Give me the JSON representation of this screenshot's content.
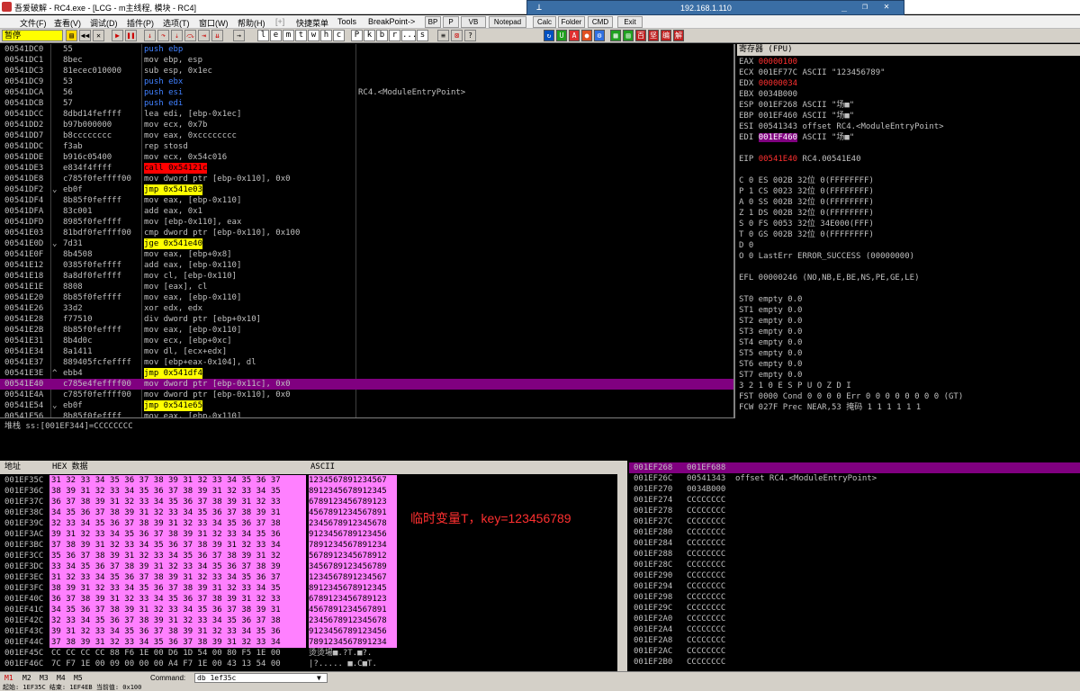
{
  "window": {
    "title": "吾爱破解 - RC4.exe - [LCG - m主线程, 模块 - RC4]"
  },
  "rdp": {
    "ip": "192.168.1.110"
  },
  "menu": [
    "文件(F)",
    "查看(V)",
    "调试(D)",
    "插件(P)",
    "选项(T)",
    "窗口(W)",
    "帮助(H)",
    "[+]",
    "快捷菜单",
    "Tools",
    "BreakPoint->"
  ],
  "plugin_buttons": [
    "BP",
    "P",
    "VB",
    "Notepad",
    "Calc",
    "Folder",
    "CMD",
    "Exit"
  ],
  "toolbar": {
    "status": "暂停",
    "letters": [
      "l",
      "e",
      "m",
      "t",
      "w",
      "h",
      "c",
      "P",
      "k",
      "b",
      "r",
      "...",
      "s"
    ]
  },
  "disasm": [
    {
      "addr": "00541DC0",
      "jmp": "",
      "hex": "55",
      "asm": "push ebp",
      "cls": "push",
      "cmt": ""
    },
    {
      "addr": "00541DC1",
      "jmp": "",
      "hex": "8bec",
      "asm": "mov ebp, esp",
      "cls": "",
      "cmt": ""
    },
    {
      "addr": "00541DC3",
      "jmp": "",
      "hex": "81ecec010000",
      "asm": "sub esp, 0x1ec",
      "cls": "",
      "cmt": ""
    },
    {
      "addr": "00541DC9",
      "jmp": "",
      "hex": "53",
      "asm": "push ebx",
      "cls": "push",
      "cmt": ""
    },
    {
      "addr": "00541DCA",
      "jmp": "",
      "hex": "56",
      "asm": "push esi",
      "cls": "push",
      "cmt": "RC4.<ModuleEntryPoint>"
    },
    {
      "addr": "00541DCB",
      "jmp": "",
      "hex": "57",
      "asm": "push edi",
      "cls": "push",
      "cmt": ""
    },
    {
      "addr": "00541DCC",
      "jmp": "",
      "hex": "8dbd14feffff",
      "asm": "lea edi, [ebp-0x1ec]",
      "cls": "",
      "cmt": ""
    },
    {
      "addr": "00541DD2",
      "jmp": "",
      "hex": "b97b000000",
      "asm": "mov ecx, 0x7b",
      "cls": "",
      "cmt": ""
    },
    {
      "addr": "00541DD7",
      "jmp": "",
      "hex": "b8cccccccc",
      "asm": "mov eax, 0xcccccccc",
      "cls": "",
      "cmt": ""
    },
    {
      "addr": "00541DDC",
      "jmp": "",
      "hex": "f3ab",
      "asm": "rep stosd",
      "cls": "",
      "cmt": ""
    },
    {
      "addr": "00541DDE",
      "jmp": "",
      "hex": "b916c05400",
      "asm": "mov ecx, 0x54c016",
      "cls": "",
      "cmt": ""
    },
    {
      "addr": "00541DE3",
      "jmp": "",
      "hex": "e834f4ffff",
      "asm": "call 0x54121c",
      "cls": "call",
      "cmt": ""
    },
    {
      "addr": "00541DE8",
      "jmp": "",
      "hex": "c785f0feffff00",
      "asm": "mov dword ptr [ebp-0x110], 0x0",
      "cls": "",
      "cmt": ""
    },
    {
      "addr": "00541DF2",
      "jmp": "⌄",
      "hex": "eb0f",
      "asm": "jmp 0x541e03",
      "cls": "jmp",
      "cmt": ""
    },
    {
      "addr": "00541DF4",
      "jmp": "",
      "hex": "8b85f0feffff",
      "asm": "mov eax, [ebp-0x110]",
      "cls": "",
      "cmt": ""
    },
    {
      "addr": "00541DFA",
      "jmp": "",
      "hex": "83c001",
      "asm": "add eax, 0x1",
      "cls": "",
      "cmt": ""
    },
    {
      "addr": "00541DFD",
      "jmp": "",
      "hex": "8985f0feffff",
      "asm": "mov [ebp-0x110], eax",
      "cls": "",
      "cmt": ""
    },
    {
      "addr": "00541E03",
      "jmp": "",
      "hex": "81bdf0feffff00",
      "asm": "cmp dword ptr [ebp-0x110], 0x100",
      "cls": "",
      "cmt": ""
    },
    {
      "addr": "00541E0D",
      "jmp": "⌄",
      "hex": "7d31",
      "asm": "jge 0x541e40",
      "cls": "jmp",
      "cmt": ""
    },
    {
      "addr": "00541E0F",
      "jmp": "",
      "hex": "8b4508",
      "asm": "mov eax, [ebp+0x8]",
      "cls": "",
      "cmt": ""
    },
    {
      "addr": "00541E12",
      "jmp": "",
      "hex": "0385f0feffff",
      "asm": "add eax, [ebp-0x110]",
      "cls": "",
      "cmt": ""
    },
    {
      "addr": "00541E18",
      "jmp": "",
      "hex": "8a8df0feffff",
      "asm": "mov cl, [ebp-0x110]",
      "cls": "",
      "cmt": ""
    },
    {
      "addr": "00541E1E",
      "jmp": "",
      "hex": "8808",
      "asm": "mov [eax], cl",
      "cls": "",
      "cmt": ""
    },
    {
      "addr": "00541E20",
      "jmp": "",
      "hex": "8b85f0feffff",
      "asm": "mov eax, [ebp-0x110]",
      "cls": "",
      "cmt": ""
    },
    {
      "addr": "00541E26",
      "jmp": "",
      "hex": "33d2",
      "asm": "xor edx, edx",
      "cls": "",
      "cmt": ""
    },
    {
      "addr": "00541E28",
      "jmp": "",
      "hex": "f77510",
      "asm": "div dword ptr [ebp+0x10]",
      "cls": "",
      "cmt": ""
    },
    {
      "addr": "00541E2B",
      "jmp": "",
      "hex": "8b85f0feffff",
      "asm": "mov eax, [ebp-0x110]",
      "cls": "",
      "cmt": ""
    },
    {
      "addr": "00541E31",
      "jmp": "",
      "hex": "8b4d0c",
      "asm": "mov ecx, [ebp+0xc]",
      "cls": "",
      "cmt": ""
    },
    {
      "addr": "00541E34",
      "jmp": "",
      "hex": "8a1411",
      "asm": "mov dl, [ecx+edx]",
      "cls": "",
      "cmt": ""
    },
    {
      "addr": "00541E37",
      "jmp": "",
      "hex": "889405fcfeffff",
      "asm": "mov [ebp+eax-0x104], dl",
      "cls": "",
      "cmt": ""
    },
    {
      "addr": "00541E3E",
      "jmp": "^",
      "hex": "ebb4",
      "asm": "jmp 0x541df4",
      "cls": "jmp",
      "cmt": ""
    },
    {
      "addr": "00541E40",
      "jmp": "",
      "hex": "c785e4feffff00",
      "asm": "mov dword ptr [ebp-0x11c], 0x0",
      "cls": "",
      "cmt": "",
      "sel": true
    },
    {
      "addr": "00541E4A",
      "jmp": "",
      "hex": "c785f0feffff00",
      "asm": "mov dword ptr [ebp-0x110], 0x0",
      "cls": "",
      "cmt": ""
    },
    {
      "addr": "00541E54",
      "jmp": "⌄",
      "hex": "eb0f",
      "asm": "jmp 0x541e65",
      "cls": "jmp",
      "cmt": ""
    },
    {
      "addr": "00541E56",
      "jmp": "",
      "hex": "8b85f0feffff",
      "asm": "mov eax, [ebp-0x110]",
      "cls": "",
      "cmt": ""
    }
  ],
  "registers": {
    "header": "寄存器 (FPU)",
    "lines": [
      [
        {
          "t": "EAX ",
          "c": "#c0c0c0"
        },
        {
          "t": "00000100",
          "c": "#ff3030"
        }
      ],
      [
        {
          "t": "ECX 001EF77C ASCII \"123456789\"",
          "c": "#c0c0c0"
        }
      ],
      [
        {
          "t": "EDX ",
          "c": "#c0c0c0"
        },
        {
          "t": "00000034",
          "c": "#ff3030"
        }
      ],
      [
        {
          "t": "EBX 0034B000",
          "c": "#c0c0c0"
        }
      ],
      [
        {
          "t": "ESP 001EF268 ASCII \"场■\"",
          "c": "#c0c0c0"
        }
      ],
      [
        {
          "t": "EBP 001EF460 ASCII \"场■\"",
          "c": "#c0c0c0"
        }
      ],
      [
        {
          "t": "ESI 00541343 offset RC4.<ModuleEntryPoint>",
          "c": "#c0c0c0"
        }
      ],
      [
        {
          "t": "EDI ",
          "c": "#c0c0c0"
        },
        {
          "t": "001EF460",
          "c": "#fff",
          "bg": "#800080"
        },
        {
          "t": " ASCII \"场■\"",
          "c": "#c0c0c0"
        }
      ],
      [
        {
          "t": "",
          "c": "#c0c0c0"
        }
      ],
      [
        {
          "t": "EIP ",
          "c": "#c0c0c0"
        },
        {
          "t": "00541E40",
          "c": "#ff3030"
        },
        {
          "t": " RC4.00541E40",
          "c": "#c0c0c0"
        }
      ],
      [
        {
          "t": "",
          "c": "#c0c0c0"
        }
      ],
      [
        {
          "t": "C 0  ES 002B 32位 0(FFFFFFFF)",
          "c": "#c0c0c0"
        }
      ],
      [
        {
          "t": "P 1  CS 0023 32位 0(FFFFFFFF)",
          "c": "#c0c0c0"
        }
      ],
      [
        {
          "t": "A 0  SS 002B 32位 0(FFFFFFFF)",
          "c": "#c0c0c0"
        }
      ],
      [
        {
          "t": "Z 1  DS 002B 32位 0(FFFFFFFF)",
          "c": "#c0c0c0"
        }
      ],
      [
        {
          "t": "S 0  FS 0053 32位 34E000(FFF)",
          "c": "#c0c0c0"
        }
      ],
      [
        {
          "t": "T 0  GS 002B 32位 0(FFFFFFFF)",
          "c": "#c0c0c0"
        }
      ],
      [
        {
          "t": "D 0",
          "c": "#c0c0c0"
        }
      ],
      [
        {
          "t": "O 0  LastErr ERROR_SUCCESS (00000000)",
          "c": "#c0c0c0"
        }
      ],
      [
        {
          "t": "",
          "c": "#c0c0c0"
        }
      ],
      [
        {
          "t": "EFL 00000246 (NO,NB,E,BE,NS,PE,GE,LE)",
          "c": "#c0c0c0"
        }
      ],
      [
        {
          "t": "",
          "c": "#c0c0c0"
        }
      ],
      [
        {
          "t": "ST0 empty 0.0",
          "c": "#c0c0c0"
        }
      ],
      [
        {
          "t": "ST1 empty 0.0",
          "c": "#c0c0c0"
        }
      ],
      [
        {
          "t": "ST2 empty 0.0",
          "c": "#c0c0c0"
        }
      ],
      [
        {
          "t": "ST3 empty 0.0",
          "c": "#c0c0c0"
        }
      ],
      [
        {
          "t": "ST4 empty 0.0",
          "c": "#c0c0c0"
        }
      ],
      [
        {
          "t": "ST5 empty 0.0",
          "c": "#c0c0c0"
        }
      ],
      [
        {
          "t": "ST6 empty 0.0",
          "c": "#c0c0c0"
        }
      ],
      [
        {
          "t": "ST7 empty 0.0",
          "c": "#c0c0c0"
        }
      ],
      [
        {
          "t": "               3 2 1 0      E S P U O Z D I",
          "c": "#c0c0c0"
        }
      ],
      [
        {
          "t": "FST 0000  Cond 0 0 0 0  Err 0 0 0 0 0 0 0 0  (GT)",
          "c": "#c0c0c0"
        }
      ],
      [
        {
          "t": "FCW 027F  Prec NEAR,53  掩码    1 1 1 1 1 1",
          "c": "#c0c0c0"
        }
      ]
    ]
  },
  "info": "堆栈 ss:[001EF344]=CCCCCCCC",
  "dump": {
    "col_addr": "地址",
    "col_hex": "HEX 数据",
    "col_ascii": "ASCII",
    "note": "临时变量T，key=123456789",
    "rows": [
      {
        "a": "001EF35C",
        "h": "31 32 33 34 35 36 37 38 39 31 32 33 34 35 36 37",
        "s": "1234567891234567"
      },
      {
        "a": "001EF36C",
        "h": "38 39 31 32 33 34 35 36 37 38 39 31 32 33 34 35",
        "s": "8912345678912345"
      },
      {
        "a": "001EF37C",
        "h": "36 37 38 39 31 32 33 34 35 36 37 38 39 31 32 33",
        "s": "6789123456789123"
      },
      {
        "a": "001EF38C",
        "h": "34 35 36 37 38 39 31 32 33 34 35 36 37 38 39 31",
        "s": "4567891234567891"
      },
      {
        "a": "001EF39C",
        "h": "32 33 34 35 36 37 38 39 31 32 33 34 35 36 37 38",
        "s": "2345678912345678"
      },
      {
        "a": "001EF3AC",
        "h": "39 31 32 33 34 35 36 37 38 39 31 32 33 34 35 36",
        "s": "9123456789123456"
      },
      {
        "a": "001EF3BC",
        "h": "37 38 39 31 32 33 34 35 36 37 38 39 31 32 33 34",
        "s": "7891234567891234"
      },
      {
        "a": "001EF3CC",
        "h": "35 36 37 38 39 31 32 33 34 35 36 37 38 39 31 32",
        "s": "5678912345678912"
      },
      {
        "a": "001EF3DC",
        "h": "33 34 35 36 37 38 39 31 32 33 34 35 36 37 38 39",
        "s": "3456789123456789"
      },
      {
        "a": "001EF3EC",
        "h": "31 32 33 34 35 36 37 38 39 31 32 33 34 35 36 37",
        "s": "1234567891234567"
      },
      {
        "a": "001EF3FC",
        "h": "38 39 31 32 33 34 35 36 37 38 39 31 32 33 34 35",
        "s": "8912345678912345"
      },
      {
        "a": "001EF40C",
        "h": "36 37 38 39 31 32 33 34 35 36 37 38 39 31 32 33",
        "s": "6789123456789123"
      },
      {
        "a": "001EF41C",
        "h": "34 35 36 37 38 39 31 32 33 34 35 36 37 38 39 31",
        "s": "4567891234567891"
      },
      {
        "a": "001EF42C",
        "h": "32 33 34 35 36 37 38 39 31 32 33 34 35 36 37 38",
        "s": "2345678912345678"
      },
      {
        "a": "001EF43C",
        "h": "39 31 32 33 34 35 36 37 38 39 31 32 33 34 35 36",
        "s": "9123456789123456"
      },
      {
        "a": "001EF44C",
        "h": "37 38 39 31 32 33 34 35 36 37 38 39 31 32 33 34",
        "s": "7891234567891234"
      },
      {
        "a": "001EF45C",
        "h": "CC CC CC CC 88 F6 1E 00 D6 1D 54 00 80 F5 1E 00",
        "s": "烫烫場■.?T.■?."
      },
      {
        "a": "001EF46C",
        "h": "7C F7 1E 00 09 00 00 00 A4 F7 1E 00 43 13 54 00",
        "s": "|?.....  ■.C■T."
      }
    ]
  },
  "stack": [
    {
      "a": "001EF268",
      "v": "001EF688",
      "c": "",
      "sel": true
    },
    {
      "a": "001EF26C",
      "v": "00541343",
      "c": "offset RC4.<ModuleEntryPoint>"
    },
    {
      "a": "001EF270",
      "v": "0034B000",
      "c": ""
    },
    {
      "a": "001EF274",
      "v": "CCCCCCCC",
      "c": ""
    },
    {
      "a": "001EF278",
      "v": "CCCCCCCC",
      "c": ""
    },
    {
      "a": "001EF27C",
      "v": "CCCCCCCC",
      "c": ""
    },
    {
      "a": "001EF280",
      "v": "CCCCCCCC",
      "c": ""
    },
    {
      "a": "001EF284",
      "v": "CCCCCCCC",
      "c": ""
    },
    {
      "a": "001EF288",
      "v": "CCCCCCCC",
      "c": ""
    },
    {
      "a": "001EF28C",
      "v": "CCCCCCCC",
      "c": ""
    },
    {
      "a": "001EF290",
      "v": "CCCCCCCC",
      "c": ""
    },
    {
      "a": "001EF294",
      "v": "CCCCCCCC",
      "c": ""
    },
    {
      "a": "001EF298",
      "v": "CCCCCCCC",
      "c": ""
    },
    {
      "a": "001EF29C",
      "v": "CCCCCCCC",
      "c": ""
    },
    {
      "a": "001EF2A0",
      "v": "CCCCCCCC",
      "c": ""
    },
    {
      "a": "001EF2A4",
      "v": "CCCCCCCC",
      "c": ""
    },
    {
      "a": "001EF2A8",
      "v": "CCCCCCCC",
      "c": ""
    },
    {
      "a": "001EF2AC",
      "v": "CCCCCCCC",
      "c": ""
    },
    {
      "a": "001EF2B0",
      "v": "CCCCCCCC",
      "c": ""
    }
  ],
  "command": {
    "tabs": [
      "M1",
      "M2",
      "M3",
      "M4",
      "M5"
    ],
    "label": "Command:",
    "value": "db 1ef35c"
  },
  "statusbar": "起始: 1EF35C 结束: 1EF4EB 当前值: 0x100",
  "colors": {
    "push": "#4080ff",
    "call_bg": "#ff0000",
    "jmp_bg": "#ffff00",
    "const": "#ff8040",
    "selection": "#800080",
    "dump_bg": "#ff80ff",
    "note": "#ff3030"
  }
}
